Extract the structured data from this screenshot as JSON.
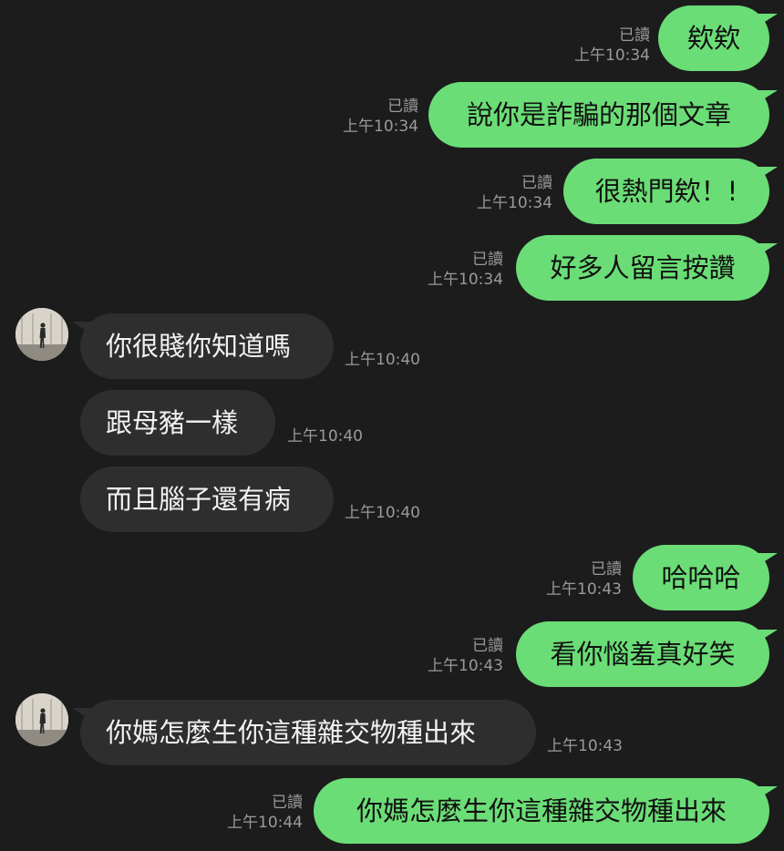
{
  "messages": [
    {
      "dir": "out",
      "text": "欸欸",
      "read": "已讀",
      "time": "上午10:34"
    },
    {
      "dir": "out",
      "text": "說你是詐騙的那個文章",
      "read": "已讀",
      "time": "上午10:34"
    },
    {
      "dir": "out",
      "text": "很熱門欸！!",
      "read": "已讀",
      "time": "上午10:34"
    },
    {
      "dir": "out",
      "text": "好多人留言按讚",
      "read": "已讀",
      "time": "上午10:34"
    },
    {
      "dir": "in",
      "text": "你很賤你知道嗎",
      "time": "上午10:40"
    },
    {
      "dir": "in",
      "text": "跟母豬一樣",
      "time": "上午10:40"
    },
    {
      "dir": "in",
      "text": "而且腦子還有病",
      "time": "上午10:40"
    },
    {
      "dir": "out",
      "text": "哈哈哈",
      "read": "已讀",
      "time": "上午10:43"
    },
    {
      "dir": "out",
      "text": "看你惱羞真好笑",
      "read": "已讀",
      "time": "上午10:43"
    },
    {
      "dir": "in",
      "text": "你媽怎麼生你這種雜交物種出來",
      "time": "上午10:43"
    },
    {
      "dir": "out",
      "text": "你媽怎麼生你這種雜交物種出來",
      "read": "已讀",
      "time": "上午10:44"
    }
  ]
}
